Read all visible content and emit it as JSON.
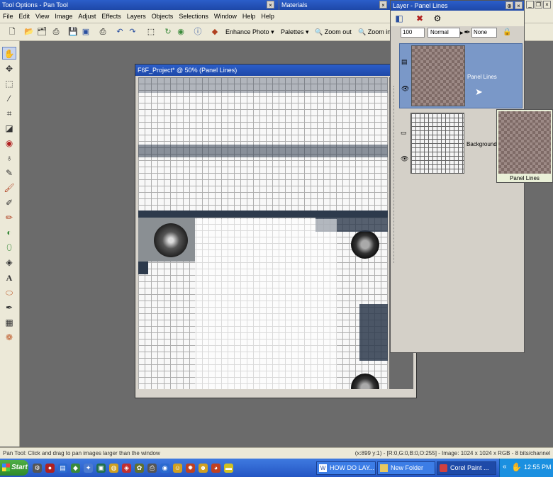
{
  "tool_options": {
    "title": "Tool Options - Pan Tool"
  },
  "materials": {
    "title": "Materials"
  },
  "menu": [
    "File",
    "Edit",
    "View",
    "Image",
    "Adjust",
    "Effects",
    "Layers",
    "Objects",
    "Selections",
    "Window",
    "Help",
    "Help"
  ],
  "toolbar": {
    "enhance_photo": "Enhance Photo",
    "palettes": "Palettes",
    "zoom_out": "Zoom out",
    "zoom_in": "Zoom in"
  },
  "image_window": {
    "title": "F6F_Project* @ 50% (Panel Lines)"
  },
  "layer_palette": {
    "title": "Layer - Panel Lines",
    "opacity": "100",
    "blend_mode": "Normal",
    "mask_mode": "None",
    "layers": [
      {
        "name": "Panel Lines",
        "selected": true
      },
      {
        "name": "Background",
        "selected": false
      }
    ],
    "drag_tooltip": "Panel Lines"
  },
  "status": {
    "left": "Pan Tool: Click and drag to pan images larger than the window",
    "right": "(x:899 y:1) - [R:0,G:0,B:0,O:255] - Image: 1024 x 1024 x RGB - 8 bits/channel"
  },
  "taskbar": {
    "start": "Start",
    "tasks": [
      {
        "label": "HOW DO LAY..."
      },
      {
        "label": "New Folder"
      },
      {
        "label": "Corel Paint ..."
      }
    ],
    "clock": "12:55 PM"
  },
  "colors": {
    "title_bar": "#2458c4",
    "selected_layer": "#7a98c8",
    "taskbar": "#2f66d0",
    "chrome": "#ece9d8"
  }
}
